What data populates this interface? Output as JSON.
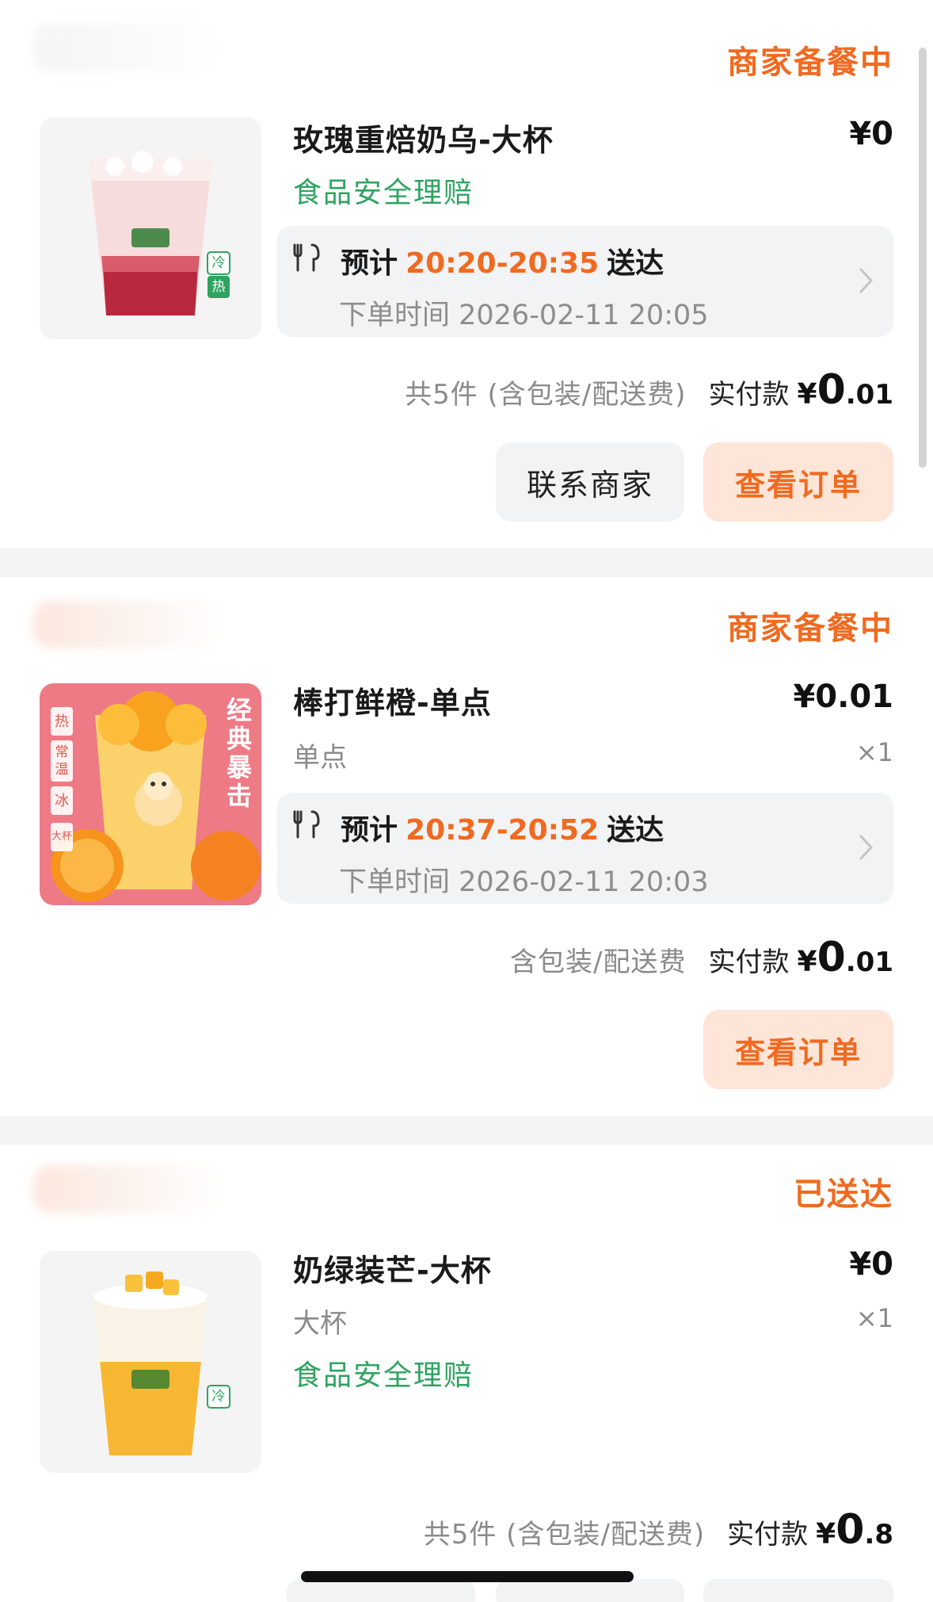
{
  "orders": [
    {
      "status": "商家备餐中",
      "item_title": "玫瑰重焙奶乌-大杯",
      "price": "¥0",
      "safety": "食品安全理赔",
      "eta_prefix": "预计",
      "eta_time": "20:20-20:35",
      "eta_suffix": "送达",
      "order_time": "下单时间 2026-02-11 20:05",
      "summary_note": "共5件 (含包装/配送费)",
      "paid_label": "实付款",
      "paid_currency": "¥",
      "paid_int": "0",
      "paid_dec": ".01",
      "contact_label": "联系商家",
      "view_label": "查看订单"
    },
    {
      "status": "商家备餐中",
      "item_title": "棒打鲜橙-单点",
      "price": "¥0.01",
      "spec": "单点",
      "qty": "×1",
      "eta_prefix": "预计",
      "eta_time": "20:37-20:52",
      "eta_suffix": "送达",
      "order_time": "下单时间 2026-02-11 20:03",
      "summary_note": "含包装/配送费",
      "paid_label": "实付款",
      "paid_currency": "¥",
      "paid_int": "0",
      "paid_dec": ".01",
      "view_label": "查看订单",
      "thumb_text": {
        "headline": "经典暴击",
        "temps": [
          "热",
          "常温",
          "冰"
        ],
        "size": "大杯"
      }
    },
    {
      "status": "已送达",
      "item_title": "奶绿装芒-大杯",
      "price": "¥0",
      "spec": "大杯",
      "qty": "×1",
      "safety": "食品安全理赔",
      "summary_note": "共5件 (含包装/配送费)",
      "paid_label": "实付款",
      "paid_currency": "¥",
      "paid_int": "0",
      "paid_dec": ".8"
    }
  ],
  "thumb_badges": {
    "cold": "冷",
    "hot": "热"
  },
  "colors": {
    "accent_orange": "#f06a20",
    "safety_green": "#2ea360",
    "muted_gray": "#8a8a8a",
    "panel_gray": "#f2f3f5"
  },
  "icons": [
    "utensils-icon",
    "chevron-right-icon"
  ]
}
